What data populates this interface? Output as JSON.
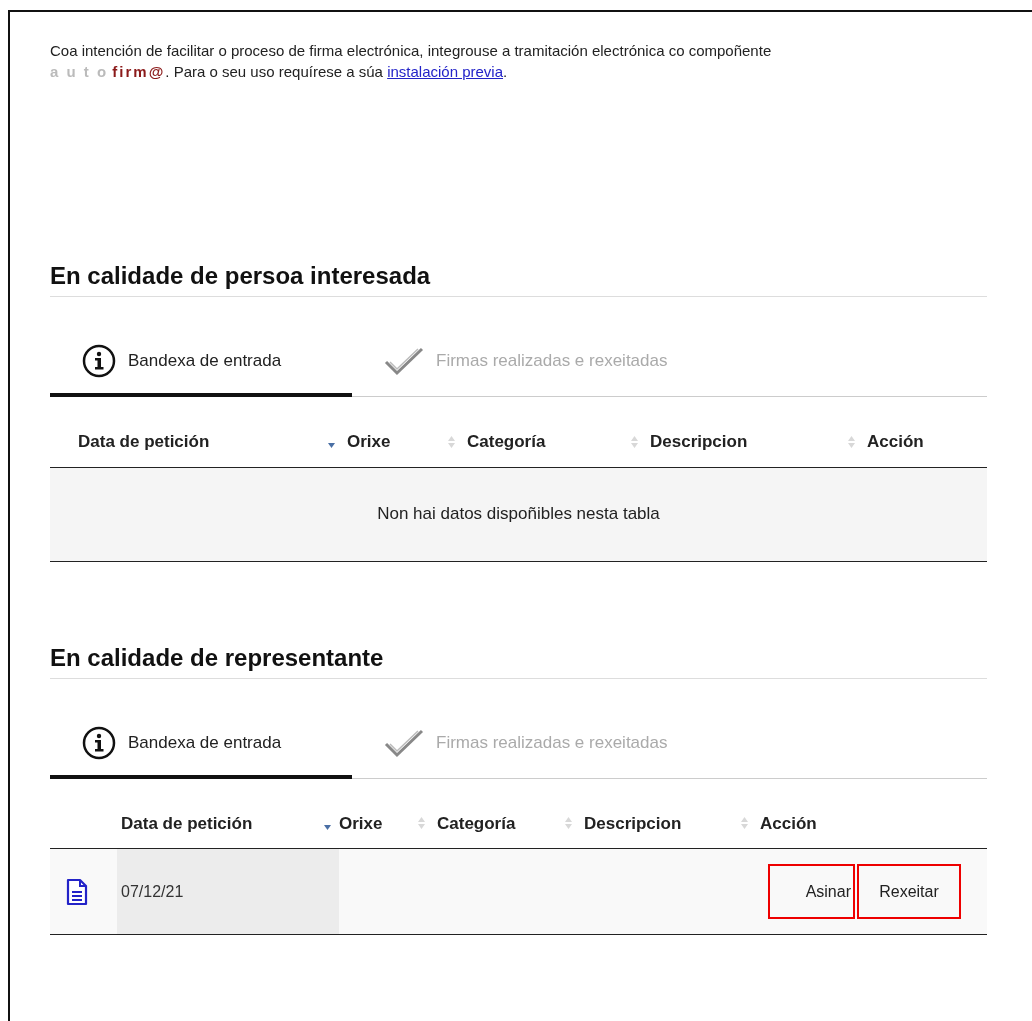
{
  "intro": {
    "before": "Coa intención de facilitar o proceso de firma electrónica, integrouse a tramitación electrónica co compoñente",
    "logo": {
      "light": "a u t o",
      "dark": "firm@"
    },
    "middle": ". Para o seu uso requírese a súa",
    "link": "instalación previa",
    "end": "."
  },
  "sections": [
    {
      "title": "En calidade de persoa interesada",
      "tabs": [
        {
          "kind": "info",
          "label": "Bandexa de entrada",
          "selected": true
        },
        {
          "kind": "check",
          "label": "Firmas realizadas e rexeitadas",
          "selected": false
        }
      ],
      "table": {
        "columns": [
          {
            "label": "Data de petición",
            "sorted": true
          },
          {
            "label": "Orixe",
            "sorted": false
          },
          {
            "label": "Categoría",
            "sorted": false
          },
          {
            "label": "Descripcion",
            "sorted": false
          },
          {
            "label": "Acción"
          }
        ],
        "empty_message": "Non hai datos dispoñibles nesta tabla"
      }
    },
    {
      "title": "En calidade de representante",
      "tabs": [
        {
          "kind": "info",
          "label": "Bandexa de entrada",
          "selected": true
        },
        {
          "kind": "check",
          "label": "Firmas realizadas e rexeitadas",
          "selected": false
        }
      ],
      "table": {
        "columns": [
          {
            "label": "Data de petición",
            "sorted": true
          },
          {
            "label": "Orixe",
            "sorted": false
          },
          {
            "label": "Categoría",
            "sorted": false
          },
          {
            "label": "Descripcion",
            "sorted": false
          },
          {
            "label": "Acción"
          }
        ],
        "rows": [
          {
            "date": "07/12/21",
            "actions": [
              "Asinar",
              "Rexeitar"
            ]
          }
        ]
      }
    }
  ]
}
